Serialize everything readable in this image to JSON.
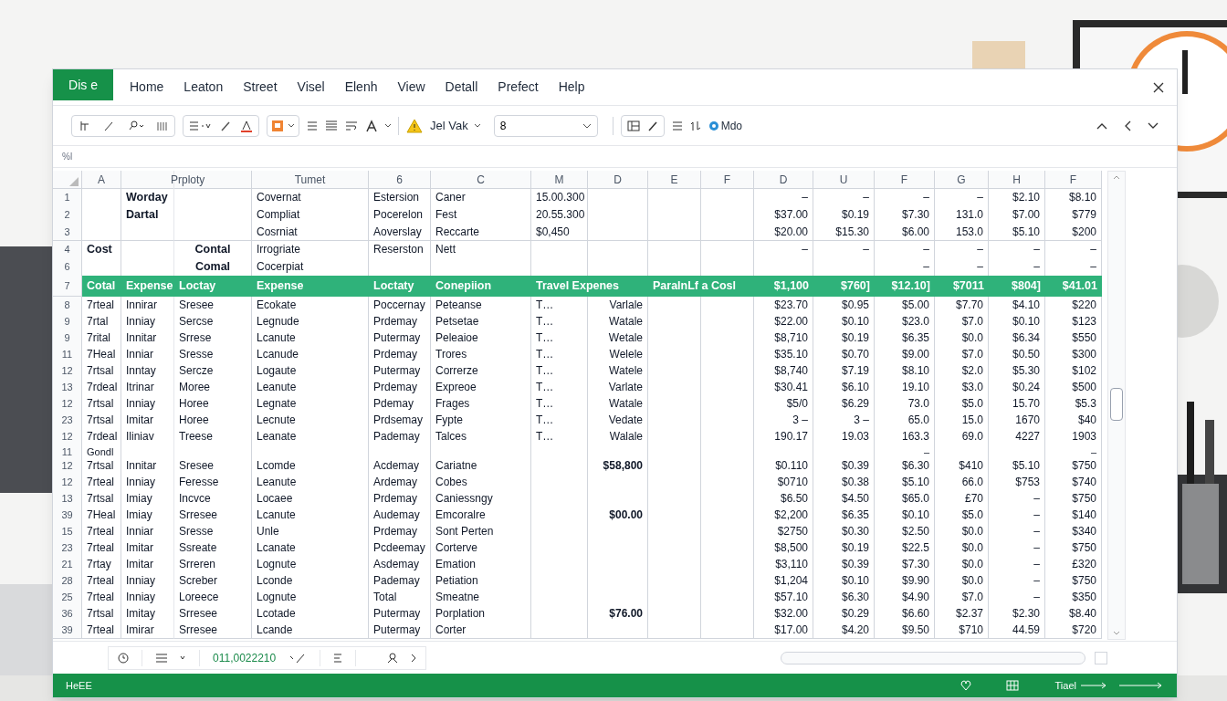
{
  "menu": {
    "file_tab": "Dis e",
    "items": [
      "Home",
      "Leaton",
      "Street",
      "Visel",
      "Elenh",
      "View",
      "Detall",
      "Prefect",
      "Help"
    ]
  },
  "ribbon": {
    "style_label": "Jel Vak",
    "font_field": "8",
    "app_label": "Mdo"
  },
  "formula_bar": {
    "label": "%l"
  },
  "sheet": {
    "columns": [
      "A",
      "",
      "Prploty",
      "Tumet",
      "6",
      "C",
      "M",
      "D",
      "E",
      "F",
      "D",
      "U",
      "F",
      "G",
      "H",
      "F"
    ],
    "rows": [
      {
        "number": "1",
        "kind": "top",
        "cells": [
          null,
          "Worday",
          null,
          "Covernat",
          "Estersion",
          "Caner",
          "15.00.300",
          null,
          null,
          null,
          "–",
          "–",
          "–",
          "–",
          "$2.10",
          "$8.10"
        ]
      },
      {
        "number": "2",
        "kind": "top",
        "cells": [
          null,
          "Dartal",
          null,
          "Compliat",
          "Pocerelon",
          "Fest",
          "20.55.300",
          null,
          null,
          null,
          "$37.00",
          "$0.19",
          "$7.30",
          "131.0",
          "$7.00",
          "$779"
        ]
      },
      {
        "number": "3",
        "kind": "top",
        "cells": [
          null,
          null,
          null,
          "Cosrniat",
          "Aoverslay",
          "Reccarte",
          "$0,450",
          null,
          null,
          null,
          "$20.00",
          "$15.30",
          "$6.00",
          "153.0",
          "$5.10",
          "$200"
        ]
      },
      {
        "number": "4",
        "kind": "top",
        "cells": [
          "Cost",
          null,
          "Contal",
          "Irrogriate",
          "Reserston",
          "Nett",
          null,
          null,
          null,
          null,
          "–",
          "–",
          "–",
          "–",
          "–",
          "–"
        ]
      },
      {
        "number": "6",
        "kind": "top",
        "cells": [
          null,
          null,
          "Comal",
          "Cocerpiat",
          null,
          null,
          null,
          null,
          null,
          null,
          null,
          null,
          "–",
          "–",
          "–",
          "–"
        ]
      },
      {
        "number": "7",
        "kind": "header",
        "cells": [
          "Cotal",
          "Expense",
          "Loctay",
          "Expense",
          "Loctaty",
          "Conepiion",
          "Travel Expenes",
          null,
          "ParalnLf a Cosl",
          null,
          "$1,100",
          "$760]",
          "$12.10]",
          "$7011",
          "$804]",
          "$41.01"
        ]
      },
      {
        "number": "8",
        "kind": "data",
        "cells": [
          "7rteal",
          "Innirar",
          "Sresee",
          "Ecokate",
          "Poccernay",
          "Peteanse",
          "T…",
          "Varlale",
          null,
          null,
          "$23.70",
          "$0.95",
          "$5.00",
          "$7.70",
          "$4.10",
          "$220"
        ]
      },
      {
        "number": "9",
        "kind": "data",
        "cells": [
          "7rtal",
          "Inniay",
          "Sercse",
          "Legnude",
          "Prdemay",
          "Petsetae",
          "T…",
          "Watale",
          null,
          null,
          "$22.00",
          "$0.10",
          "$23.0",
          "$7.0",
          "$0.10",
          "$123"
        ]
      },
      {
        "number": "9",
        "kind": "data",
        "cells": [
          "7rital",
          "Innitar",
          "Srrese",
          "Lcanute",
          "Putermay",
          "Peleaioe",
          "T…",
          "Wetale",
          null,
          null,
          "$8,710",
          "$0.19",
          "$6.35",
          "$0.0",
          "$6.34",
          "$550"
        ]
      },
      {
        "number": "11",
        "kind": "data",
        "cells": [
          "7Heal",
          "Inniar",
          "Sresse",
          "Lcanude",
          "Prdemay",
          "Trores",
          "T…",
          "Welele",
          null,
          null,
          "$35.10",
          "$0.70",
          "$9.00",
          "$7.0",
          "$0.50",
          "$300"
        ]
      },
      {
        "number": "12",
        "kind": "data",
        "cells": [
          "7rtsal",
          "Inntay",
          "Sercze",
          "Logaute",
          "Putermay",
          "Correrze",
          "T…",
          "Watele",
          null,
          null,
          "$8,740",
          "$7.19",
          "$8.10",
          "$2.0",
          "$5.30",
          "$102"
        ]
      },
      {
        "number": "13",
        "kind": "data",
        "cells": [
          "7rdeal",
          "Itrinar",
          "Moree",
          "Leanute",
          "Prdemay",
          "Expreoe",
          "T…",
          "Varlate",
          null,
          null,
          "$30.41",
          "$6.10",
          "19.10",
          "$3.0",
          "$0.24",
          "$500"
        ]
      },
      {
        "number": "12",
        "kind": "data",
        "cells": [
          "7rtsal",
          "Inniay",
          "Horee",
          "Legnate",
          "Pdemay",
          "Frages",
          "T…",
          "Watale",
          null,
          null,
          "$5/0",
          "$6.29",
          "73.0",
          "$5.0",
          "15.70",
          "$5.3"
        ]
      },
      {
        "number": "23",
        "kind": "data",
        "cells": [
          "7rtsal",
          "Imitar",
          "Horee",
          "Lecnute",
          "Prdsemay",
          "Fypte",
          "T…",
          "Vedate",
          null,
          null,
          "3 –",
          "3 –",
          "65.0",
          "15.0",
          "1670",
          "$40"
        ]
      },
      {
        "number": "12",
        "kind": "data",
        "cells": [
          "7rdeal",
          "Iliniav",
          "Treese",
          "Leanate",
          "Pademay",
          "Talces",
          "T…",
          "Walale",
          null,
          null,
          "190.17",
          "19.03",
          "163.3",
          "69.0",
          "4227",
          "1903"
        ]
      },
      {
        "number": "11",
        "kind": "group",
        "cells": [
          "Gondl",
          null,
          null,
          null,
          null,
          null,
          null,
          null,
          null,
          null,
          null,
          null,
          "–",
          null,
          null,
          "–"
        ]
      },
      {
        "number": "12",
        "kind": "data",
        "cells": [
          "7rtsal",
          "Innitar",
          "Sresee",
          "Lcomde",
          "Acdemay",
          "Cariatne",
          null,
          "$58,800",
          null,
          null,
          "$0.110",
          "$0.39",
          "$6.30",
          "$410",
          "$5.10",
          "$750"
        ]
      },
      {
        "number": "12",
        "kind": "data",
        "cells": [
          "7rteal",
          "Inniay",
          "Feresse",
          "Leanute",
          "Ardemay",
          "Cobes",
          null,
          null,
          null,
          null,
          "$0710",
          "$0.38",
          "$5.10",
          "66.0",
          "$753",
          "$740"
        ]
      },
      {
        "number": "13",
        "kind": "data",
        "cells": [
          "7rtsal",
          "Imiay",
          "Incvce",
          "Locaee",
          "Prdemay",
          "Caniessngy",
          null,
          null,
          null,
          null,
          "$6.50",
          "$4.50",
          "$65.0",
          "£70",
          "–",
          "$750"
        ]
      },
      {
        "number": "39",
        "kind": "data",
        "cells": [
          "7Heal",
          "Imiay",
          "Srresee",
          "Lcanute",
          "Audemay",
          "Emcoralre",
          null,
          "$00.00",
          null,
          null,
          "$2,200",
          "$6.35",
          "$0.10",
          "$5.0",
          "–",
          "$140"
        ]
      },
      {
        "number": "15",
        "kind": "data",
        "cells": [
          "7rteal",
          "Inniar",
          "Sresse",
          "Unle",
          "Prdemay",
          "Sont Perten",
          null,
          null,
          null,
          null,
          "$2750",
          "$0.30",
          "$2.50",
          "$0.0",
          "–",
          "$340"
        ]
      },
      {
        "number": "23",
        "kind": "data",
        "cells": [
          "7rteal",
          "Imitar",
          "Ssreate",
          "Lcanate",
          "Pcdeemay",
          "Corterve",
          null,
          null,
          null,
          null,
          "$8,500",
          "$0.19",
          "$22.5",
          "$0.0",
          "–",
          "$750"
        ]
      },
      {
        "number": "21",
        "kind": "data",
        "cells": [
          "7rtay",
          "Imitar",
          "Srreren",
          "Lognute",
          "Asdemay",
          "Emation",
          null,
          null,
          null,
          null,
          "$3,110",
          "$0.39",
          "$7.30",
          "$0.0",
          "–",
          "£320"
        ]
      },
      {
        "number": "28",
        "kind": "data",
        "cells": [
          "7rteal",
          "Inniay",
          "Screber",
          "Lconde",
          "Pademay",
          "Petiation",
          null,
          null,
          null,
          null,
          "$1,204",
          "$0.10",
          "$9.90",
          "$0.0",
          "–",
          "$750"
        ]
      },
      {
        "number": "25",
        "kind": "data",
        "cells": [
          "7rteal",
          "Inniay",
          "Loreece",
          "Lognute",
          "Total",
          "Smeatne",
          null,
          null,
          null,
          null,
          "$57.10",
          "$6.30",
          "$4.90",
          "$7.0",
          "–",
          "$350"
        ]
      },
      {
        "number": "36",
        "kind": "data",
        "cells": [
          "7rtsal",
          "Imitay",
          "Srresee",
          "Lcotade",
          "Putermay",
          "Porplation",
          null,
          "$76.00",
          null,
          null,
          "$32.00",
          "$0.29",
          "$6.60",
          "$2.37",
          "$2.30",
          "$8.40"
        ]
      },
      {
        "number": "39",
        "kind": "data",
        "cells": [
          "7rteal",
          "Imirar",
          "Srresee",
          "Lcande",
          "Putermay",
          "Corter",
          null,
          null,
          null,
          null,
          "$17.00",
          "$4.20",
          "$9.50",
          "$710",
          "44.59",
          "$720"
        ]
      }
    ]
  },
  "bottom_bar": {
    "cell_reference": "011,0022210"
  },
  "status_bar": {
    "left": "HeEE",
    "right": "Tiael"
  }
}
